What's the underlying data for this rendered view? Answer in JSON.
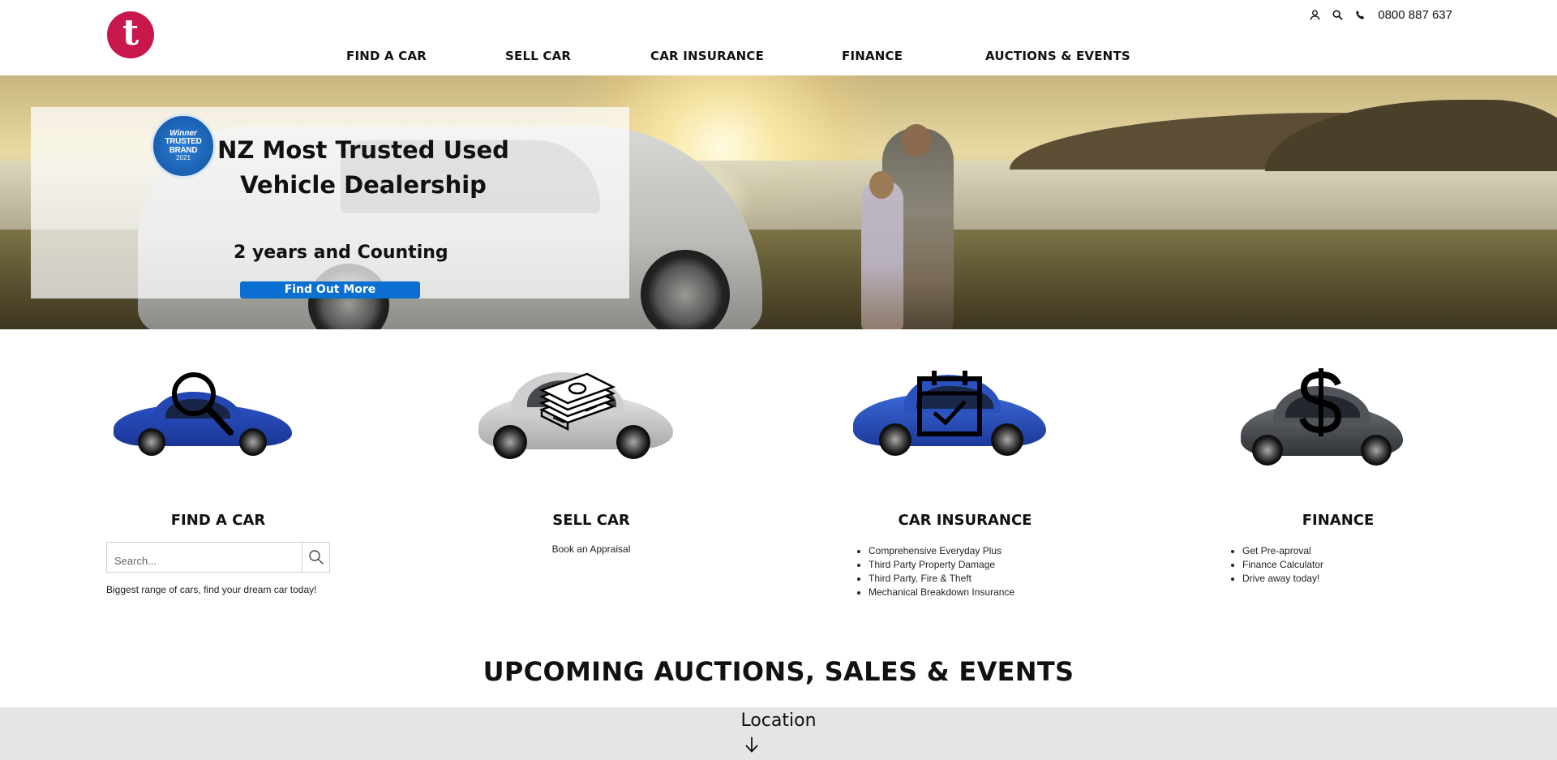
{
  "header": {
    "logo_letter": "t",
    "phone": "0800 887 637",
    "icons": [
      "user-icon",
      "search-icon",
      "phone-icon"
    ],
    "brand_color": "#c8174a"
  },
  "nav": {
    "items": [
      {
        "label": "FIND A CAR"
      },
      {
        "label": "SELL CAR"
      },
      {
        "label": "CAR INSURANCE"
      },
      {
        "label": "FINANCE"
      },
      {
        "label": "AUCTIONS & EVENTS"
      }
    ]
  },
  "hero": {
    "badge": {
      "line1": "Winner",
      "line2": "TRUSTED BRAND",
      "line3": "2021"
    },
    "title": "NZ Most Trusted Used Vehicle Dealership",
    "subtitle": "2 years and Counting",
    "button": "Find Out More",
    "button_color": "#0a6fd1"
  },
  "features": [
    {
      "title": "FIND A CAR",
      "icon": "magnifier-icon",
      "search_placeholder": "Search...",
      "text": "Biggest range of cars, find your dream car today!"
    },
    {
      "title": "SELL CAR",
      "icon": "money-stack-icon",
      "text": "Book an Appraisal"
    },
    {
      "title": "CAR INSURANCE",
      "icon": "calendar-check-icon",
      "items": [
        "Comprehensive Everyday Plus",
        "Third Party Property Damage",
        "Third Party, Fire & Theft",
        "Mechanical Breakdown Insurance"
      ]
    },
    {
      "title": "FINANCE",
      "icon": "dollar-icon",
      "items": [
        "Get Pre-aproval",
        "Finance Calculator",
        "Drive away today!"
      ]
    }
  ],
  "events": {
    "title": "UPCOMING AUCTIONS, SALES & EVENTS",
    "location_label": "Location"
  }
}
